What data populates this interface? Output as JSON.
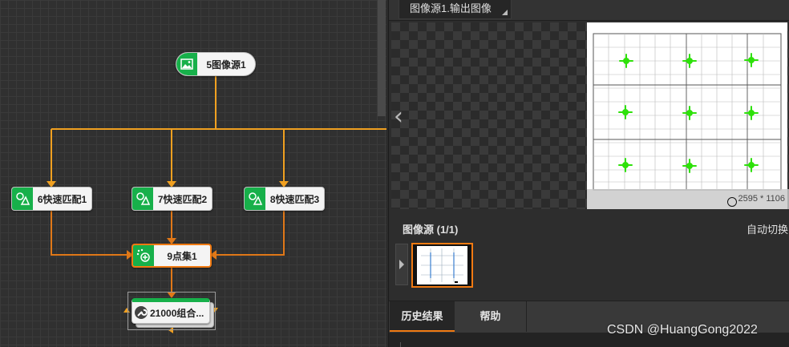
{
  "flow": {
    "nodes": {
      "image_source": {
        "label": "5图像源1",
        "icon": "image-icon"
      },
      "fast_match_1": {
        "label": "6快速匹配1",
        "icon": "shape-match-icon"
      },
      "fast_match_2": {
        "label": "7快速匹配2",
        "icon": "shape-match-icon"
      },
      "fast_match_3": {
        "label": "8快速匹配3",
        "icon": "shape-match-icon"
      },
      "point_set": {
        "label": "9点集1",
        "icon": "point-set-icon"
      },
      "combo": {
        "label": "21000组合...",
        "icon": "wrench-icon"
      }
    },
    "colors": {
      "wire": "#f0a020",
      "node_accent": "#17b04a",
      "selected_border": "#f07a12"
    }
  },
  "image_view": {
    "title": "图像源1.输出图像",
    "status_text": "2595 * 1106",
    "prev_arrow": "‹"
  },
  "image_source_panel": {
    "title": "图像源 (1/1)",
    "auto_switch": "自动切换"
  },
  "tabs": [
    {
      "label": "历史结果",
      "active": true
    },
    {
      "label": "帮助",
      "active": false
    }
  ],
  "watermark": "CSDN @HuangGong2022"
}
